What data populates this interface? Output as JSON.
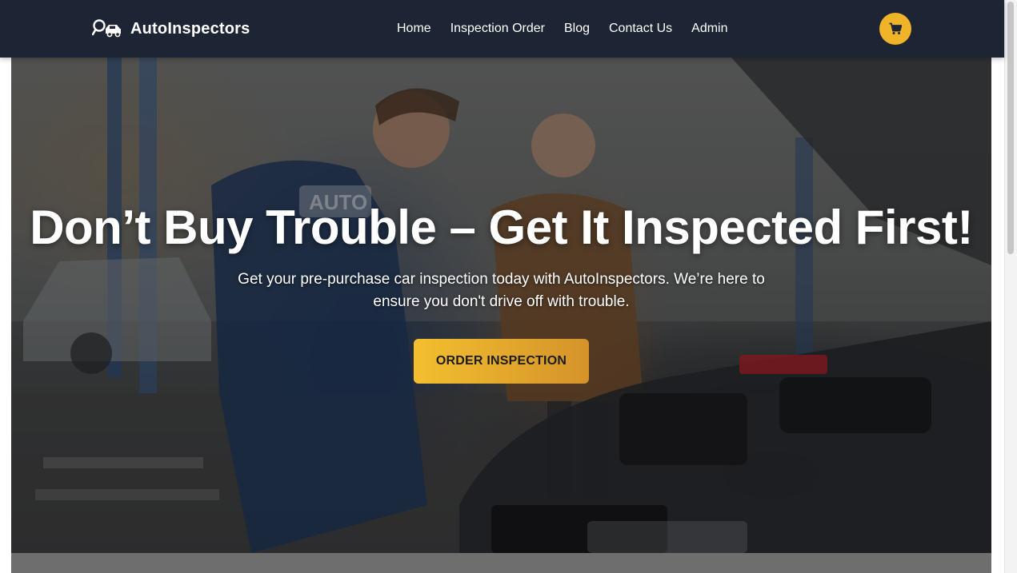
{
  "brand": {
    "name": "AutoInspectors",
    "logo_icon": "magnifier-car-logo-icon"
  },
  "nav": {
    "items": [
      {
        "label": "Home"
      },
      {
        "label": "Inspection Order"
      },
      {
        "label": "Blog"
      },
      {
        "label": "Contact Us"
      },
      {
        "label": "Admin"
      }
    ]
  },
  "cart": {
    "icon": "shopping-cart-icon",
    "color": "#f0b429"
  },
  "hero": {
    "title": "Don’t Buy Trouble – Get It Inspected First!",
    "subtitle": "Get your pre-purchase car inspection today with AutoInspectors. We’re here to ensure you don't drive off with trouble.",
    "cta_label": "ORDER INSPECTION",
    "background_image": "mechanic inspecting car engine with customer",
    "badge_text": "AUTO"
  },
  "colors": {
    "header_bg": "#1d2433",
    "accent": "#f0b429",
    "cta_gradient_start": "#f3bf2f",
    "cta_gradient_end": "#d4932a"
  }
}
